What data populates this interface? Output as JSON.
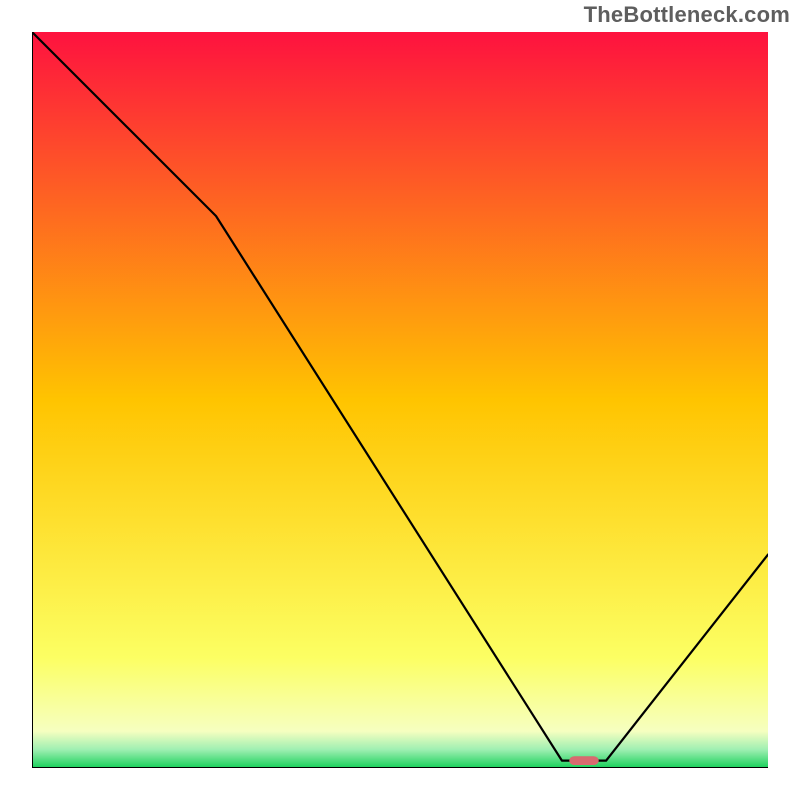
{
  "watermark": "TheBottleneck.com",
  "chart_data": {
    "type": "line",
    "title": "",
    "xlabel": "",
    "ylabel": "",
    "xlim": [
      0,
      100
    ],
    "ylim": [
      0,
      100
    ],
    "grid": false,
    "legend": false,
    "x": [
      0,
      25,
      72,
      78,
      100
    ],
    "values": [
      100,
      75,
      1,
      1,
      29
    ],
    "marker": {
      "x": 75,
      "y": 1,
      "color": "#d86a6f",
      "width_pct": 4,
      "height_pct": 1.2
    },
    "background_gradient": {
      "stops": [
        {
          "offset": 0.0,
          "color": "#fe123f"
        },
        {
          "offset": 0.5,
          "color": "#ffc400"
        },
        {
          "offset": 0.85,
          "color": "#fcff63"
        },
        {
          "offset": 0.95,
          "color": "#f6ffc0"
        },
        {
          "offset": 0.975,
          "color": "#9fefb2"
        },
        {
          "offset": 1.0,
          "color": "#17d05a"
        }
      ]
    },
    "axis_color": "#000000",
    "line_color": "#000000",
    "line_width": 2.2
  }
}
